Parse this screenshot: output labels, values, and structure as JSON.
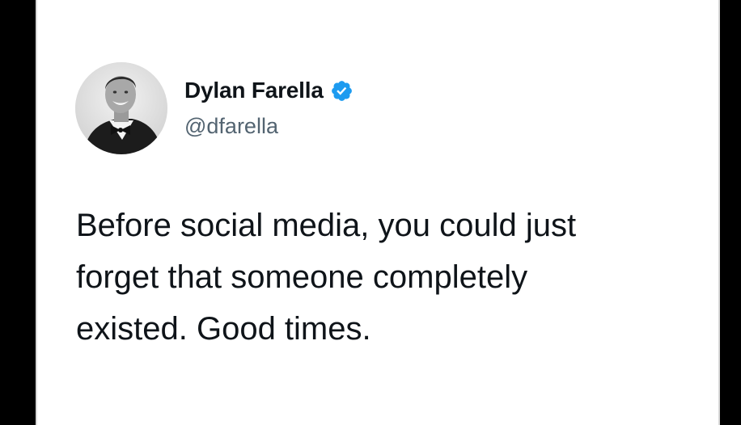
{
  "tweet": {
    "author": {
      "display_name": "Dylan Farella",
      "handle": "@dfarella",
      "verified": true,
      "avatar_icon": "profile-photo",
      "verified_icon": "verified-badge-icon",
      "verified_color": "#1d9bf0"
    },
    "text_lines": [
      "Before social media, you could just",
      "forget that someone completely",
      "existed. Good times."
    ]
  },
  "colors": {
    "background_frame": "#000000",
    "card": "#ffffff",
    "text_primary": "#0f1419",
    "text_secondary": "#536471"
  }
}
